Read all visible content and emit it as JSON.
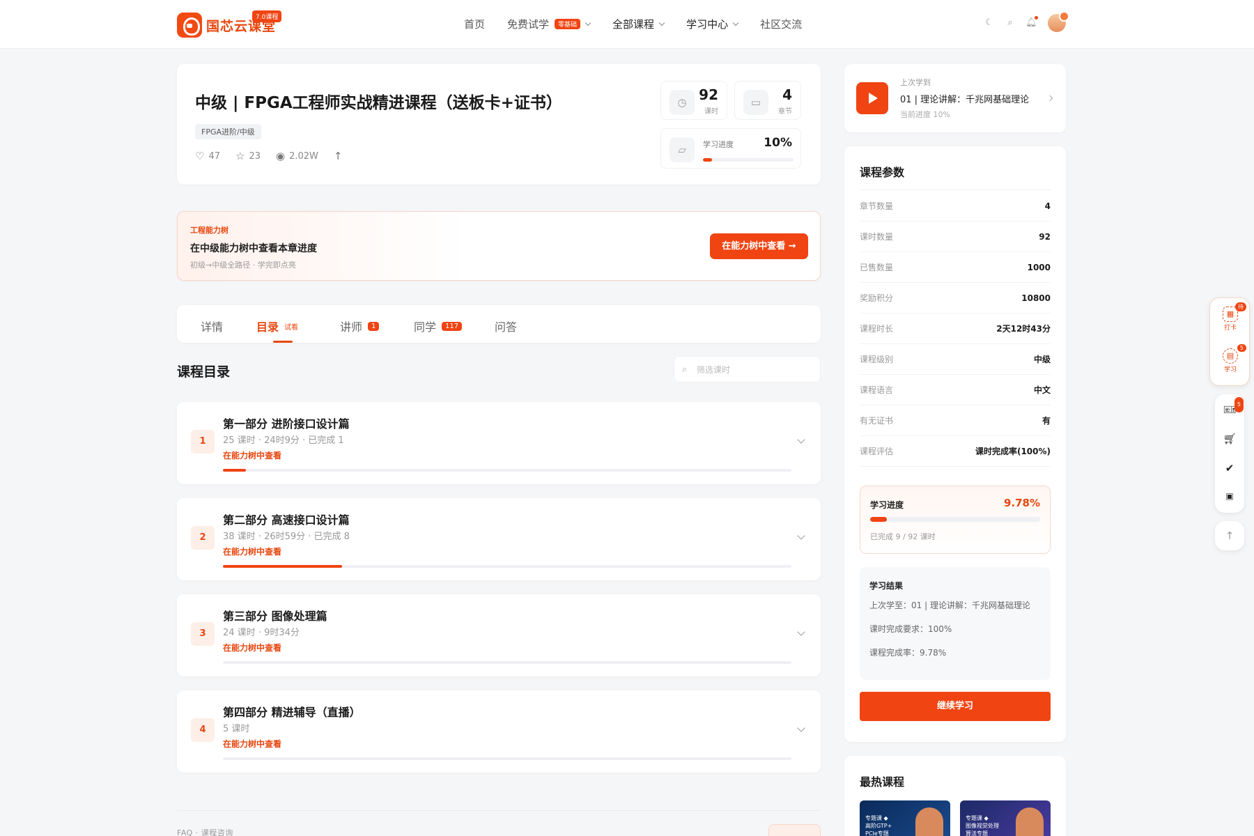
{
  "header": {
    "logo_text": "国芯云课堂",
    "logo_badge": "7.0课程",
    "nav": [
      {
        "label": "首页",
        "badge": "",
        "caret": false
      },
      {
        "label": "免费试学",
        "badge": "零基础",
        "caret": true
      },
      {
        "label": "全部课程",
        "badge": "",
        "caret": true
      },
      {
        "label": "学习中心",
        "badge": "",
        "caret": true
      },
      {
        "label": "社区交流",
        "badge": "",
        "caret": false
      }
    ],
    "icons": [
      "moon-icon",
      "search-icon",
      "bell-icon",
      "avatar"
    ]
  },
  "course": {
    "title": "中级 | FPGA工程师实战精进课程（送板卡+证书）",
    "tag": "FPGA进阶/中级",
    "likes": "47",
    "stars": "23",
    "views": "2.02W",
    "stats": {
      "lessons_num": "92",
      "lessons_label": "课时",
      "chapters_num": "4",
      "chapters_label": "章节",
      "progress_label": "学习进度",
      "progress_value": "10%",
      "progress_fraction": 0.1
    }
  },
  "ability": {
    "kicker": "工程能力树",
    "title": "在中级能力树中查看本章进度",
    "subtitle": "初级→中级全路径 · 学完即点亮",
    "button": "在能力树中查看 →"
  },
  "tabs": [
    {
      "label": "详情",
      "sub": "",
      "badge": ""
    },
    {
      "label": "目录",
      "sub": "试看",
      "badge": ""
    },
    {
      "label": "讲师",
      "sub": "",
      "badge": "1"
    },
    {
      "label": "同学",
      "sub": "",
      "badge": "117"
    },
    {
      "label": "问答",
      "sub": "",
      "badge": ""
    }
  ],
  "catalog": {
    "title": "课程目录",
    "filter_placeholder": "筛选课时",
    "chapters": [
      {
        "num": "1",
        "title": "第一部分 进阶接口设计篇",
        "meta": "25 课时 · 24时9分 · 已完成 1",
        "link": "在能力树中查看",
        "progress": 0.04
      },
      {
        "num": "2",
        "title": "第二部分 高速接口设计篇",
        "meta": "38 课时 · 26时59分 · 已完成 8",
        "link": "在能力树中查看",
        "progress": 0.21
      },
      {
        "num": "3",
        "title": "第三部分 图像处理篇",
        "meta": "24 课时 · 9时34分",
        "link": "在能力树中查看",
        "progress": 0
      },
      {
        "num": "4",
        "title": "第四部分 精进辅导（直播）",
        "meta": "5 课时",
        "link": "在能力树中查看",
        "progress": 0
      }
    ]
  },
  "faq": {
    "label": "FAQ · 课程咨询"
  },
  "last_learned": {
    "kicker": "上次学到",
    "title": "01 | 理论讲解：千兆网基础理论",
    "progress": "当前进度 10%"
  },
  "params": {
    "title": "课程参数",
    "rows": [
      {
        "k": "章节数量",
        "v": "4"
      },
      {
        "k": "课时数量",
        "v": "92"
      },
      {
        "k": "已售数量",
        "v": "1000"
      },
      {
        "k": "奖励积分",
        "v": "10800"
      },
      {
        "k": "课程时长",
        "v": "2天12时43分"
      },
      {
        "k": "课程级别",
        "v": "中级"
      },
      {
        "k": "课程语言",
        "v": "中文"
      },
      {
        "k": "有无证书",
        "v": "有"
      },
      {
        "k": "课程评估",
        "v": "课时完成率(100%)"
      }
    ],
    "learn_label": "学习进度",
    "learn_value": "9.78%",
    "learn_fraction": 0.0978,
    "learn_sub": "已完成 9 / 92 课时",
    "result_title": "学习结果",
    "result_lines": [
      "上次学至：01 | 理论讲解：千兆网基础理论",
      "课时完成要求：100%",
      "课程完成率：9.78%"
    ],
    "continue": "继续学习"
  },
  "hot": {
    "title": "最热课程",
    "thumbs": [
      {
        "text": "专题课 ◆\n高阶GTP+\nPCIe专题"
      },
      {
        "text": "专题课 ◆\n图像视觉处理\n算法专题"
      }
    ]
  },
  "side": {
    "checkin_label": "打卡",
    "checkin_badge": "待",
    "study_label": "学习",
    "study_badge": "5",
    "ticket_badge": "5"
  }
}
